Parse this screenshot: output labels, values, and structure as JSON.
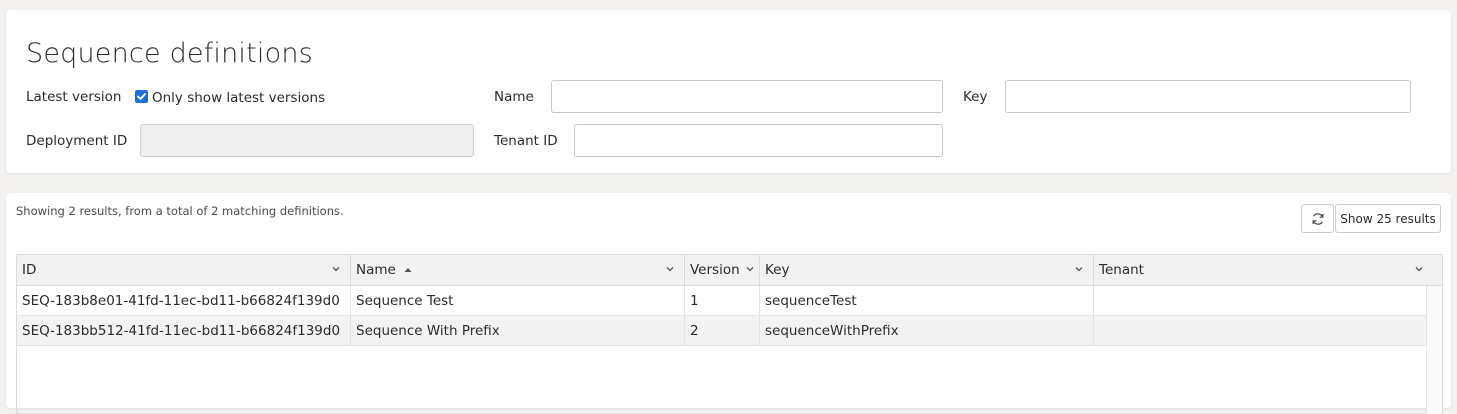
{
  "filters": {
    "title": "Sequence definitions",
    "latest_version_label": "Latest version",
    "only_latest_label": "Only show latest versions",
    "only_latest_checked": true,
    "name_label": "Name",
    "name_value": "",
    "key_label": "Key",
    "key_value": "",
    "deployment_id_label": "Deployment ID",
    "deployment_id_value": "",
    "tenant_id_label": "Tenant ID",
    "tenant_id_value": ""
  },
  "results": {
    "summary": "Showing 2 results, from a total of 2 matching definitions.",
    "refresh_icon": "refresh-icon",
    "show_results_label": "Show 25 results",
    "columns": [
      {
        "label": "ID",
        "icon": "chevron-down-icon"
      },
      {
        "label": "Name",
        "sort": "ascending",
        "icon": "chevron-down-icon"
      },
      {
        "label": "Version",
        "icon": "chevron-down-icon"
      },
      {
        "label": "Key",
        "icon": "chevron-down-icon"
      },
      {
        "label": "Tenant",
        "icon": "chevron-down-icon"
      }
    ],
    "rows": [
      {
        "id": "SEQ-183b8e01-41fd-11ec-bd11-b66824f139d0",
        "name": "Sequence Test",
        "version": "1",
        "key": "sequenceTest",
        "tenant": ""
      },
      {
        "id": "SEQ-183bb512-41fd-11ec-bd11-b66824f139d0",
        "name": "Sequence With Prefix",
        "version": "2",
        "key": "sequenceWithPrefix",
        "tenant": ""
      }
    ]
  },
  "colors": {
    "accent": "#1f6fd6",
    "page_bg": "#f3f2f0",
    "header_bg": "#f2f2f2",
    "alt_row_bg": "#f3f3f3"
  }
}
